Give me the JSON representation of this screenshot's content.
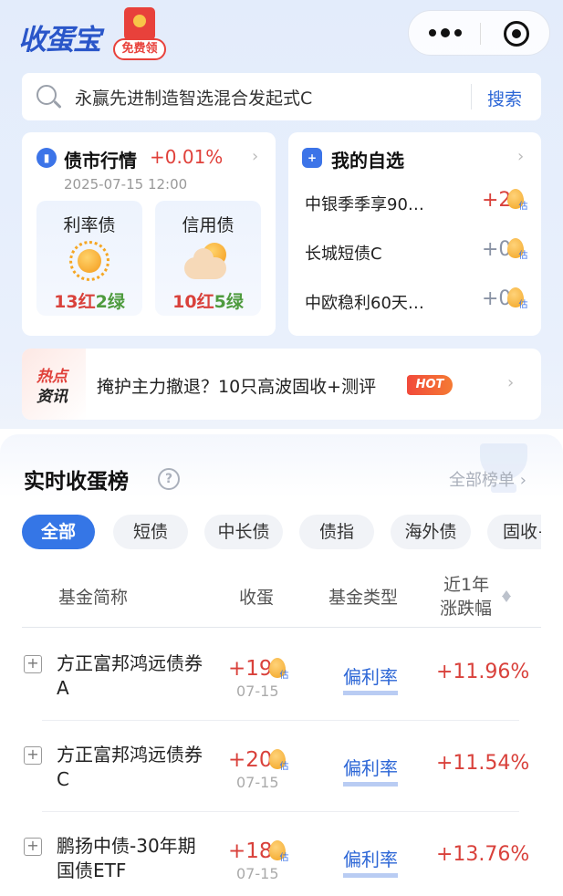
{
  "app": {
    "logo_text": "收蛋宝",
    "promo_label": "免费领"
  },
  "search": {
    "placeholder": "永赢先进制造智选混合发起式C",
    "button_label": "搜索"
  },
  "bond_market": {
    "title": "债市行情",
    "change": "+0.01%",
    "date": "2025-07-15 12:00",
    "segments": [
      {
        "name": "利率债",
        "weather": "sunny",
        "up": "13红",
        "down": "2绿"
      },
      {
        "name": "信用债",
        "weather": "partly-cloudy",
        "up": "10红",
        "down": "5绿"
      }
    ]
  },
  "watchlist": {
    "title": "我的自选",
    "items": [
      {
        "name": "中银季季享90…",
        "value": "+2",
        "egg_tag": "估",
        "color": "#d9413b"
      },
      {
        "name": "长城短债C",
        "value": "+0",
        "egg_tag": "估",
        "color": "#8a93a5"
      },
      {
        "name": "中欧稳利60天…",
        "value": "+0",
        "egg_tag": "估",
        "color": "#8a93a5"
      }
    ]
  },
  "hot_news": {
    "badge_line1": "热点",
    "badge_line2": "资讯",
    "text": "掩护主力撤退？10只高波固收+测评",
    "hot_label": "HOT"
  },
  "ranking": {
    "title": "实时收蛋榜",
    "help_label": "?",
    "all_link": "全部榜单 ›",
    "chips": [
      "全部",
      "短债",
      "中长债",
      "债指",
      "海外债",
      "固收+"
    ],
    "active_chip": "全部",
    "columns": {
      "name": "基金简称",
      "eggs": "收蛋",
      "type": "基金类型",
      "change_line1": "近1年",
      "change_line2": "涨跌幅"
    },
    "rows": [
      {
        "name": "方正富邦鸿远债券A",
        "eggs": "+19",
        "egg_tag": "估",
        "date": "07-15",
        "type": "偏利率",
        "change": "+11.96%"
      },
      {
        "name": "方正富邦鸿远债券C",
        "eggs": "+20",
        "egg_tag": "估",
        "date": "07-15",
        "type": "偏利率",
        "change": "+11.54%"
      },
      {
        "name": "鹏扬中债-30年期国债ETF",
        "eggs": "+18",
        "egg_tag": "估",
        "date": "07-15",
        "type": "偏利率",
        "change": "+13.76%"
      }
    ]
  },
  "colors": {
    "accent": "#3576e6",
    "up_red": "#d9413b",
    "down_green": "#4e9b3e",
    "neutral": "#8a93a5"
  }
}
